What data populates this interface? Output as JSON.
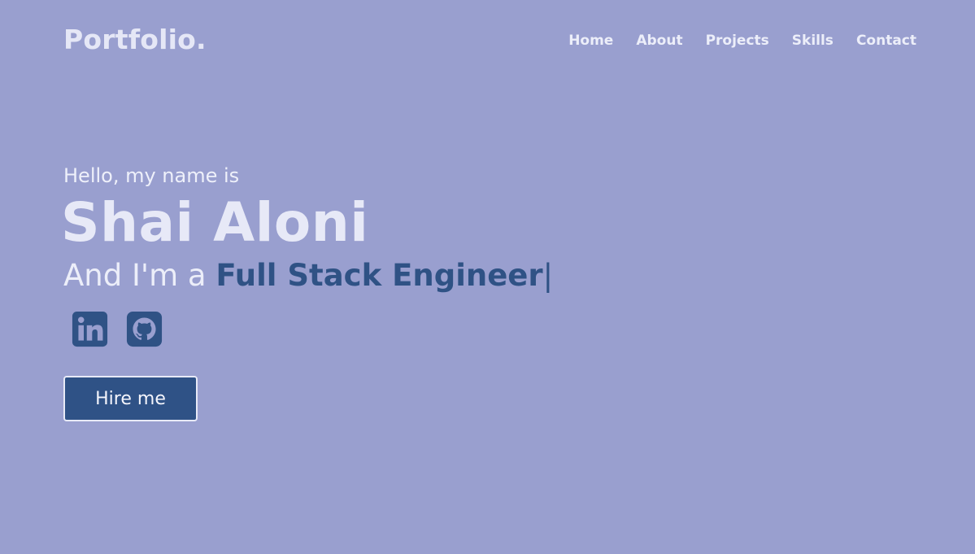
{
  "header": {
    "logo": "Portfolio.",
    "nav": [
      {
        "label": "Home"
      },
      {
        "label": "About"
      },
      {
        "label": "Projects"
      },
      {
        "label": "Skills"
      },
      {
        "label": "Contact"
      }
    ]
  },
  "hero": {
    "greeting": "Hello, my name is",
    "name": "Shai Aloni",
    "role_prefix": "And I'm a ",
    "role_title": "Full Stack Engineer",
    "cursor": "|",
    "socials": [
      {
        "icon": "linkedin-icon"
      },
      {
        "icon": "github-icon"
      }
    ],
    "cta_label": "Hire me"
  },
  "colors": {
    "background": "#999fcf",
    "accent": "#2f5285",
    "text_light": "#eceef9"
  }
}
